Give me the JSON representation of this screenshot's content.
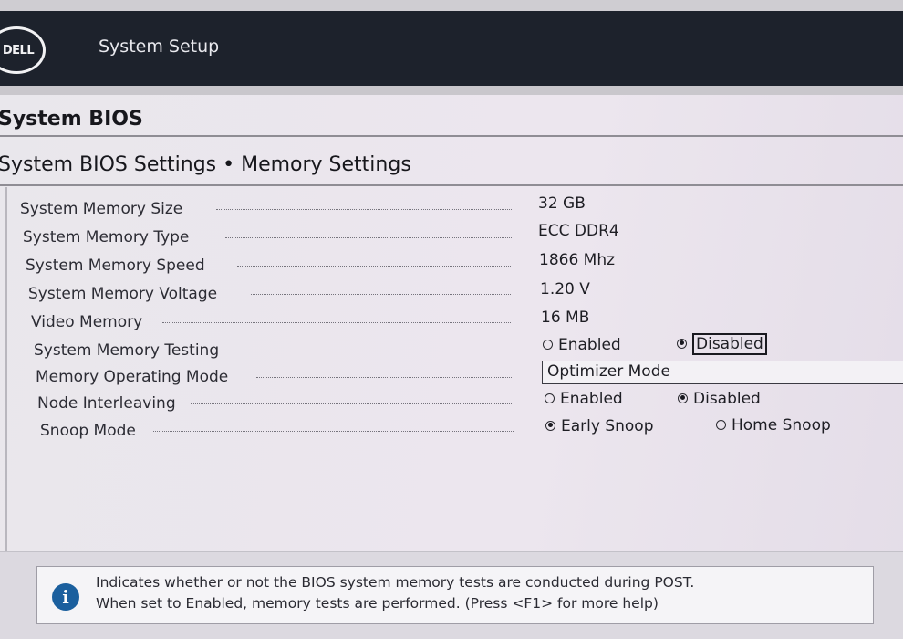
{
  "header": {
    "brand": "DELL",
    "title": "System Setup"
  },
  "page": {
    "title": "System BIOS",
    "breadcrumb": "System BIOS Settings • Memory Settings"
  },
  "settings": [
    {
      "label": "System Memory Size",
      "value": "32 GB"
    },
    {
      "label": "System Memory Type",
      "value": "ECC DDR4"
    },
    {
      "label": "System Memory Speed",
      "value": "1866 Mhz"
    },
    {
      "label": "System Memory Voltage",
      "value": "1.20 V"
    },
    {
      "label": "Video Memory",
      "value": "16 MB"
    },
    {
      "label": "System Memory Testing",
      "options": [
        "Enabled",
        "Disabled"
      ],
      "selected": "Disabled"
    },
    {
      "label": "Memory Operating Mode",
      "value": "Optimizer Mode"
    },
    {
      "label": "Node Interleaving",
      "options": [
        "Enabled",
        "Disabled"
      ],
      "selected": "Disabled"
    },
    {
      "label": "Snoop Mode",
      "options": [
        "Early Snoop",
        "Home Snoop"
      ],
      "selected": "Early Snoop"
    }
  ],
  "help": {
    "icon": "info-icon",
    "line1": "Indicates whether or not the BIOS system memory tests are conducted during POST.",
    "line2": "When set to Enabled, memory tests are performed. (Press <F1> for more help)"
  }
}
